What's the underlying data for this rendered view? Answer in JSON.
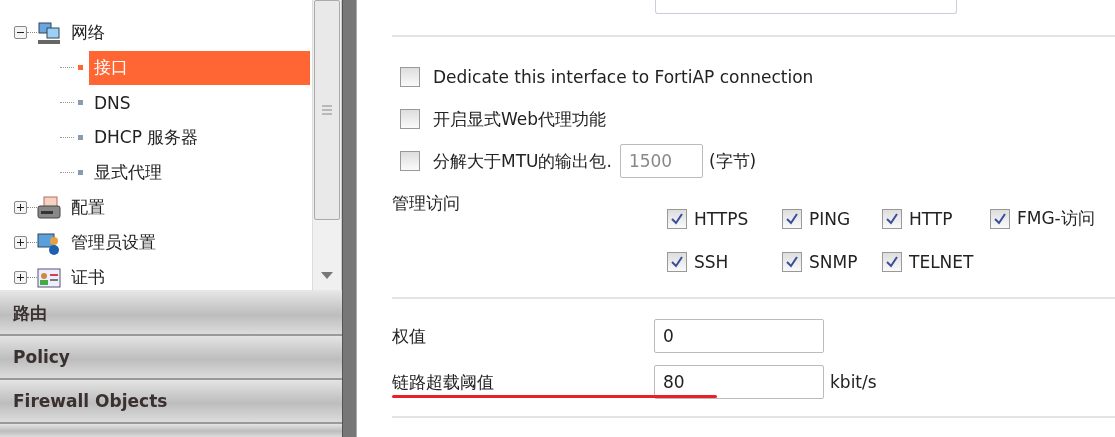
{
  "sidebar": {
    "tree": [
      {
        "label": "网络",
        "expanded": true,
        "selected": false,
        "children": [
          {
            "label": "接口",
            "selected": true
          },
          {
            "label": "DNS",
            "selected": false
          },
          {
            "label": "DHCP 服务器",
            "selected": false
          },
          {
            "label": "显式代理",
            "selected": false
          }
        ]
      },
      {
        "label": "配置",
        "expanded": false,
        "selected": false
      },
      {
        "label": "管理员设置",
        "expanded": false,
        "selected": false
      },
      {
        "label": "证书",
        "expanded": false,
        "selected": false
      }
    ],
    "sections": [
      {
        "label": "路由"
      },
      {
        "label": "Policy"
      },
      {
        "label": "Firewall Objects"
      }
    ]
  },
  "form": {
    "options": [
      {
        "label": "Dedicate this interface to FortiAP connection",
        "checked": false
      },
      {
        "label": "开启显式Web代理功能",
        "checked": false
      },
      {
        "label": "分解大于MTU的输出包.",
        "checked": false
      }
    ],
    "mtu": {
      "value": "1500",
      "disabled": true,
      "unit": "(字节)"
    },
    "access": {
      "label": "管理访问",
      "items": [
        {
          "label": "HTTPS",
          "checked": true
        },
        {
          "label": "PING",
          "checked": true
        },
        {
          "label": "HTTP",
          "checked": true
        },
        {
          "label": "FMG-访问",
          "checked": true
        },
        {
          "label": "SSH",
          "checked": true
        },
        {
          "label": "SNMP",
          "checked": true
        },
        {
          "label": "TELNET",
          "checked": true
        }
      ]
    },
    "weight": {
      "label": "权值",
      "value": "0"
    },
    "threshold": {
      "label": "链路超载阈值",
      "value": "80",
      "unit": "kbit/s"
    }
  }
}
